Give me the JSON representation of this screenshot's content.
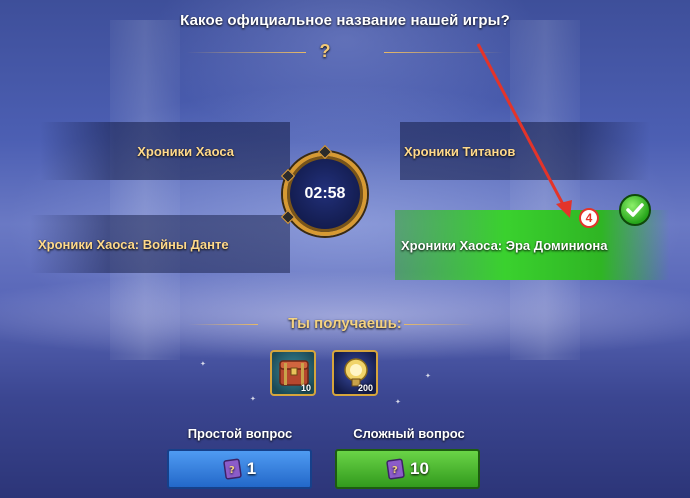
{
  "question": {
    "text": "Какое официальное название нашей игры?",
    "marker": "?"
  },
  "answers": [
    {
      "label": "Хроники Хаоса",
      "state": "normal"
    },
    {
      "label": "Хроники Титанов",
      "state": "normal"
    },
    {
      "label": "Хроники Хаоса: Войны Данте",
      "state": "normal"
    },
    {
      "label": "Хроники Хаоса: Эра Доминиона",
      "state": "correct"
    }
  ],
  "timer": {
    "value": "02:58"
  },
  "annotation": {
    "badge_number": "4",
    "color": "#e3342a"
  },
  "rewards": {
    "title": "Ты получаешь:",
    "items": [
      {
        "icon": "chest-icon",
        "quantity": "10"
      },
      {
        "icon": "potion-icon",
        "quantity": "200"
      }
    ]
  },
  "modes": [
    {
      "label": "Простой вопрос",
      "cost": "1",
      "color": "#2f7fdc"
    },
    {
      "label": "Сложный вопрос",
      "cost": "10",
      "color": "#3fb02a"
    }
  ],
  "colors": {
    "accent_gold": "#f4d280",
    "correct_green": "#3ad12e"
  }
}
